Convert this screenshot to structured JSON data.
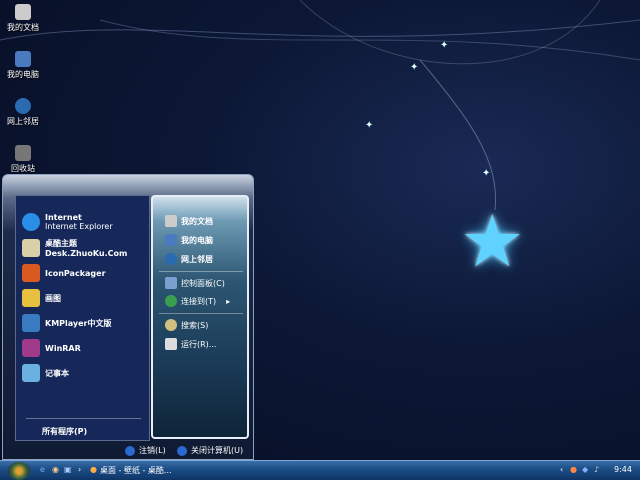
{
  "desktop_icons": [
    {
      "label": "我的文档",
      "icon": "documents-icon"
    },
    {
      "label": "我的电脑",
      "icon": "computer-icon"
    },
    {
      "label": "网上邻居",
      "icon": "network-icon"
    },
    {
      "label": "回收站",
      "icon": "recycle-bin-icon"
    }
  ],
  "start_menu": {
    "pinned": [
      {
        "title": "Internet",
        "subtitle": "Internet Explorer",
        "icon": "internet-explorer-icon",
        "color": "#2a8ee8"
      },
      {
        "title": "桌酷主题Desk.ZhuoKu.Com",
        "icon": "zhuoku-icon",
        "color": "#d8d0a8"
      },
      {
        "title": "IconPackager",
        "icon": "iconpackager-icon",
        "color": "#d85a20"
      },
      {
        "title": "画图",
        "icon": "paint-icon",
        "color": "#e8c040"
      },
      {
        "title": "KMPlayer中文版",
        "icon": "kmplayer-icon",
        "color": "#3a7ac0"
      },
      {
        "title": "WinRAR",
        "icon": "winrar-icon",
        "color": "#a03a8a"
      },
      {
        "title": "记事本",
        "icon": "notepad-icon",
        "color": "#6ab0e0"
      }
    ],
    "all_programs": "所有程序(P)",
    "places": [
      {
        "label": "我的文档",
        "icon": "documents-icon"
      },
      {
        "label": "我的电脑",
        "icon": "computer-icon"
      },
      {
        "label": "网上邻居",
        "icon": "network-icon"
      },
      {
        "label": "控制面板(C)",
        "icon": "control-panel-icon"
      },
      {
        "label": "连接到(T)",
        "icon": "connect-icon"
      },
      {
        "label": "搜索(S)",
        "icon": "search-icon"
      },
      {
        "label": "运行(R)...",
        "icon": "run-icon"
      }
    ],
    "logoff": "注销(L)",
    "shutdown": "关闭计算机(U)"
  },
  "taskbar": {
    "task": "桌面 - 壁纸 - 桌酷...",
    "clock": "9:44"
  }
}
